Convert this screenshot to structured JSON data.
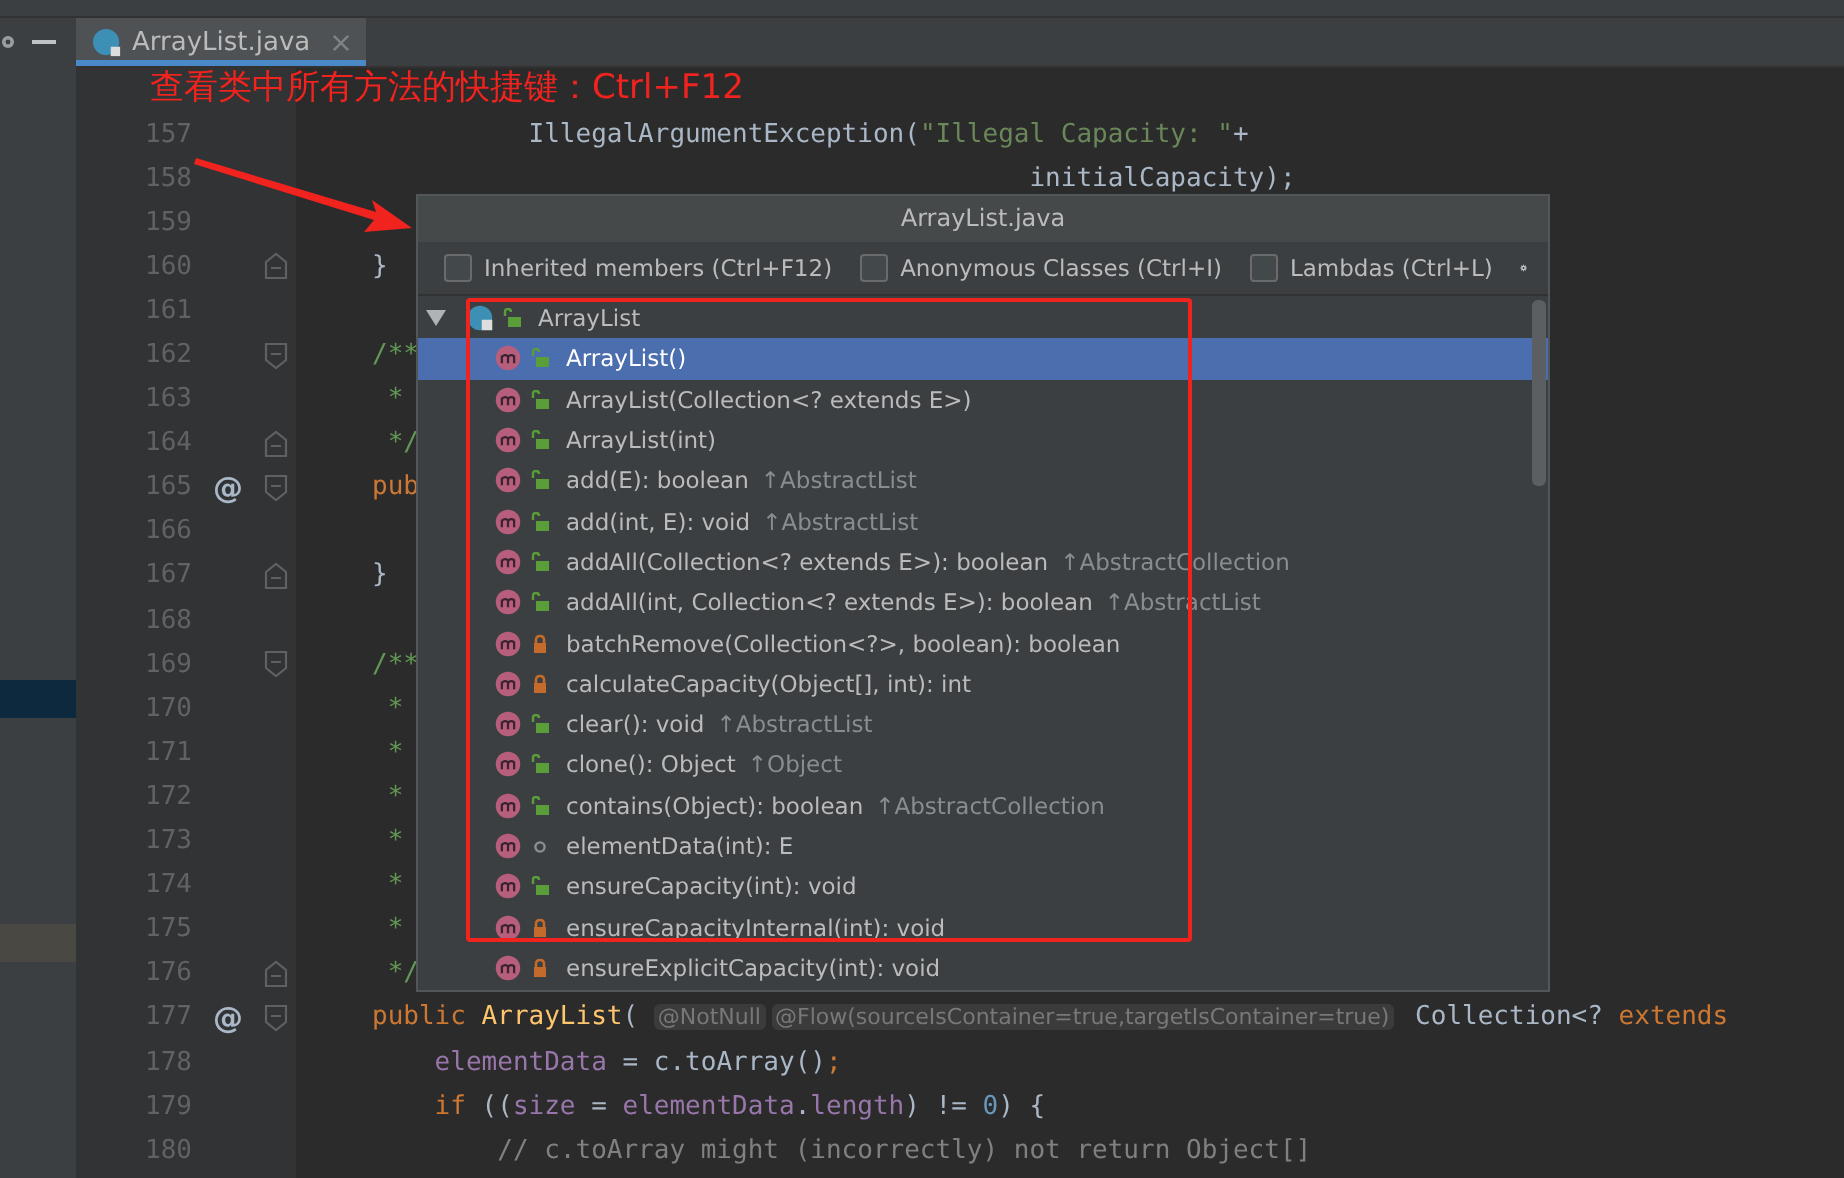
{
  "tabs": [
    {
      "title": "ArrayList.java",
      "selected": true
    }
  ],
  "annotation": {
    "text": "查看类中所有方法的快捷键：Ctrl+F12"
  },
  "editor": {
    "lines": [
      {
        "number": "157",
        "kind": "plain",
        "segments": [
          {
            "kind": "plain",
            "text": "          IllegalArgumentException("
          },
          {
            "kind": "string",
            "text": "\"Illegal Capacity: \""
          },
          {
            "kind": "plain",
            "text": "+"
          }
        ]
      },
      {
        "number": "158",
        "kind": "plain",
        "segments": [
          {
            "kind": "plain",
            "text": "                                          initialCapacity);"
          }
        ]
      },
      {
        "number": "159",
        "kind": "plain"
      },
      {
        "number": "160",
        "kind": "fold-end",
        "segments": [
          {
            "kind": "plain",
            "text": "}"
          }
        ]
      },
      {
        "number": "161",
        "kind": "plain"
      },
      {
        "number": "162",
        "kind": "fold-start",
        "segments": [
          {
            "kind": "doc",
            "text": "/**"
          }
        ]
      },
      {
        "number": "163",
        "kind": "plain",
        "segments": [
          {
            "kind": "doc",
            "text": " *"
          }
        ]
      },
      {
        "number": "164",
        "kind": "fold-end",
        "segments": [
          {
            "kind": "doc",
            "text": " */"
          }
        ]
      },
      {
        "number": "165",
        "kind": "fold-start",
        "mark": "@",
        "segments": [
          {
            "kind": "keyword",
            "text": "pub"
          }
        ]
      },
      {
        "number": "166",
        "kind": "plain"
      },
      {
        "number": "167",
        "kind": "fold-end",
        "segments": [
          {
            "kind": "plain",
            "text": "}"
          }
        ]
      },
      {
        "number": "168",
        "kind": "plain"
      },
      {
        "number": "169",
        "kind": "fold-start",
        "segments": [
          {
            "kind": "doc",
            "text": "/**"
          }
        ]
      },
      {
        "number": "170",
        "kind": "plain",
        "segments": [
          {
            "kind": "doc",
            "text": " *"
          }
        ]
      },
      {
        "number": "171",
        "kind": "plain",
        "segments": [
          {
            "kind": "doc",
            "text": " *"
          }
        ]
      },
      {
        "number": "172",
        "kind": "plain",
        "segments": [
          {
            "kind": "doc",
            "text": " *"
          }
        ]
      },
      {
        "number": "173",
        "kind": "plain",
        "segments": [
          {
            "kind": "doc",
            "text": " *"
          }
        ]
      },
      {
        "number": "174",
        "kind": "plain",
        "segments": [
          {
            "kind": "doc",
            "text": " *"
          }
        ]
      },
      {
        "number": "175",
        "kind": "plain",
        "segments": [
          {
            "kind": "doc",
            "text": " *"
          }
        ]
      },
      {
        "number": "176",
        "kind": "fold-end",
        "segments": [
          {
            "kind": "doc",
            "text": " */"
          }
        ]
      },
      {
        "number": "177",
        "kind": "fold-start",
        "mark": "@",
        "segments": [
          {
            "kind": "keyword",
            "text": "public "
          },
          {
            "kind": "method",
            "text": "ArrayList"
          },
          {
            "kind": "plain",
            "text": "( "
          },
          {
            "kind": "hint",
            "text": "@NotNull"
          },
          {
            "kind": "hint",
            "text": "@Flow(sourceIsContainer=true,targetIsContainer=true)"
          },
          {
            "kind": "plain",
            "text": " Collection<? "
          },
          {
            "kind": "keyword",
            "text": "extends"
          }
        ]
      },
      {
        "number": "178",
        "kind": "plain",
        "segments": [
          {
            "kind": "field",
            "text": "    elementData"
          },
          {
            "kind": "plain",
            "text": " = c.toArray()"
          },
          {
            "kind": "keyword",
            "text": ";"
          }
        ]
      },
      {
        "number": "179",
        "kind": "plain",
        "segments": [
          {
            "kind": "keyword",
            "text": "    if "
          },
          {
            "kind": "plain",
            "text": "(("
          },
          {
            "kind": "field",
            "text": "size"
          },
          {
            "kind": "plain",
            "text": " = "
          },
          {
            "kind": "field",
            "text": "elementData"
          },
          {
            "kind": "plain",
            "text": "."
          },
          {
            "kind": "field",
            "text": "length"
          },
          {
            "kind": "plain",
            "text": ") != "
          },
          {
            "kind": "number",
            "text": "0"
          },
          {
            "kind": "plain",
            "text": ") {"
          }
        ]
      },
      {
        "number": "180",
        "kind": "plain",
        "segments": [
          {
            "kind": "comment",
            "text": "        // c.toArray might (incorrectly) not return Object[]"
          }
        ]
      }
    ]
  },
  "popup": {
    "title": "ArrayList.java",
    "options": [
      {
        "label": "Inherited members (Ctrl+F12)",
        "checked": false
      },
      {
        "label": "Anonymous Classes (Ctrl+I)",
        "checked": false
      },
      {
        "label": "Lambdas (Ctrl+L)",
        "checked": false
      }
    ],
    "tree": [
      {
        "kind": "public-class",
        "signature": "ArrayList",
        "expanded": true,
        "selected": false,
        "children": [
          {
            "kind": "public-method",
            "signature": "ArrayList()",
            "selected": true
          },
          {
            "kind": "public-method",
            "signature": "ArrayList(Collection<? extends E>)",
            "selected": false
          },
          {
            "kind": "public-method",
            "signature": "ArrayList(int)",
            "selected": false
          },
          {
            "kind": "public-method",
            "signature": "add(E): boolean",
            "origin": "↑AbstractList",
            "selected": false
          },
          {
            "kind": "public-method",
            "signature": "add(int, E): void",
            "origin": "↑AbstractList",
            "selected": false
          },
          {
            "kind": "public-method",
            "signature": "addAll(Collection<? extends E>): boolean",
            "origin": "↑AbstractCollection",
            "selected": false
          },
          {
            "kind": "public-method",
            "signature": "addAll(int, Collection<? extends E>): boolean",
            "origin": "↑AbstractList",
            "selected": false
          },
          {
            "kind": "private-method",
            "signature": "batchRemove(Collection<?>, boolean): boolean",
            "selected": false
          },
          {
            "kind": "private-method",
            "signature": "calculateCapacity(Object[], int): int",
            "selected": false
          },
          {
            "kind": "public-method",
            "signature": "clear(): void",
            "origin": "↑AbstractList",
            "selected": false
          },
          {
            "kind": "public-method",
            "signature": "clone(): Object",
            "origin": "↑Object",
            "selected": false
          },
          {
            "kind": "public-method",
            "signature": "contains(Object): boolean",
            "origin": "↑AbstractCollection",
            "selected": false
          },
          {
            "kind": "package-method",
            "signature": "elementData(int): E",
            "selected": false
          },
          {
            "kind": "public-method",
            "signature": "ensureCapacity(int): void",
            "selected": false
          },
          {
            "kind": "private-method",
            "signature": "ensureCapacityInternal(int): void",
            "selected": false
          },
          {
            "kind": "private-method",
            "signature": "ensureExplicitCapacity(int): void",
            "selected": false
          }
        ]
      }
    ]
  }
}
